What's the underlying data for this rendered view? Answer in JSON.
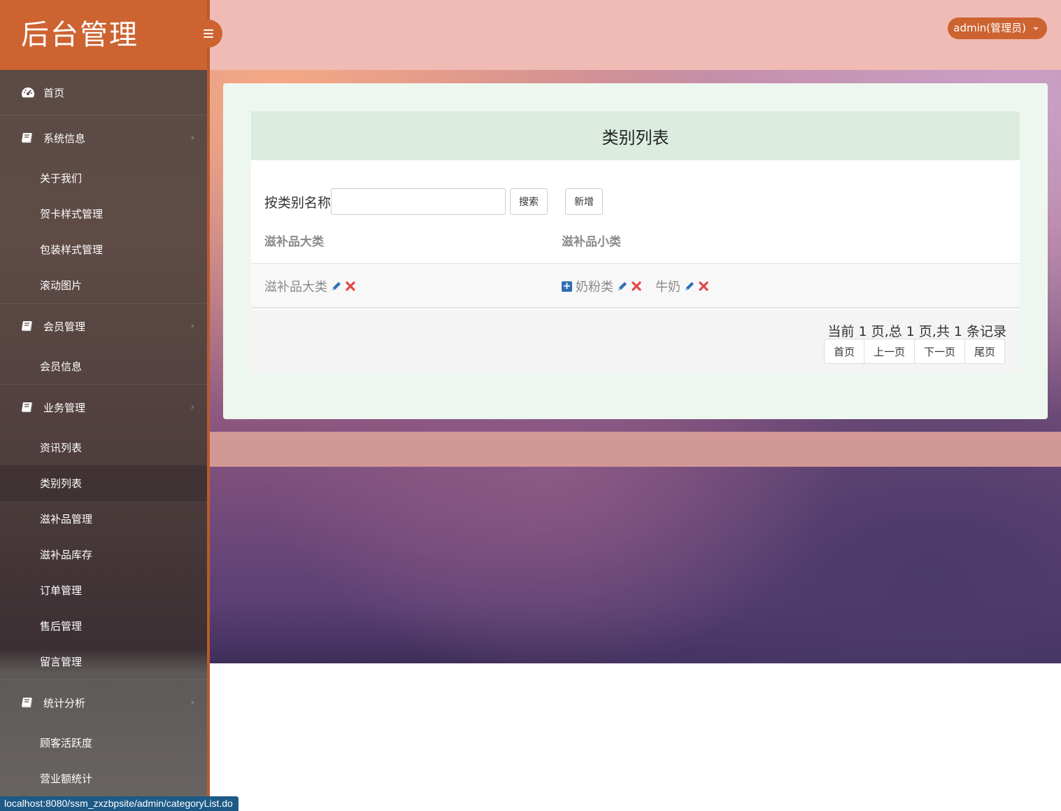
{
  "brand": {
    "title": "后台管理"
  },
  "header": {
    "user_label": "admin(管理员)"
  },
  "sidebar": {
    "home": "首页",
    "sections": [
      {
        "label": "系统信息",
        "items": [
          "关于我们",
          "贺卡样式管理",
          "包装样式管理",
          "滚动图片"
        ]
      },
      {
        "label": "会员管理",
        "items": [
          "会员信息"
        ]
      },
      {
        "label": "业务管理",
        "items": [
          "资讯列表",
          "类别列表",
          "滋补品管理",
          "滋补品库存",
          "订单管理",
          "售后管理",
          "留言管理"
        ]
      },
      {
        "label": "统计分析",
        "items": [
          "顾客活跃度",
          "营业额统计"
        ]
      }
    ],
    "active_item": "类别列表"
  },
  "main": {
    "title": "类别列表",
    "search": {
      "label": "按类别名称",
      "value": "",
      "search_button": "搜索",
      "add_button": "新增"
    },
    "table": {
      "headers": [
        "滋补品大类",
        "滋补品小类"
      ],
      "rows": [
        {
          "major": "滋补品大类",
          "minors": [
            "奶粉类",
            "牛奶"
          ]
        }
      ]
    },
    "pagination": {
      "info": "当前 1 页,总 1 页,共 1 条记录",
      "buttons": [
        "首页",
        "上一页",
        "下一页",
        "尾页"
      ]
    }
  },
  "statusbar": {
    "url": "localhost:8080/ssm_zxzbpsite/admin/categoryList.do"
  },
  "colors": {
    "accent": "#cd6331",
    "header_bg": "#f0bbb4",
    "edit_icon": "#2f6fb4",
    "delete_icon": "#e04848"
  }
}
